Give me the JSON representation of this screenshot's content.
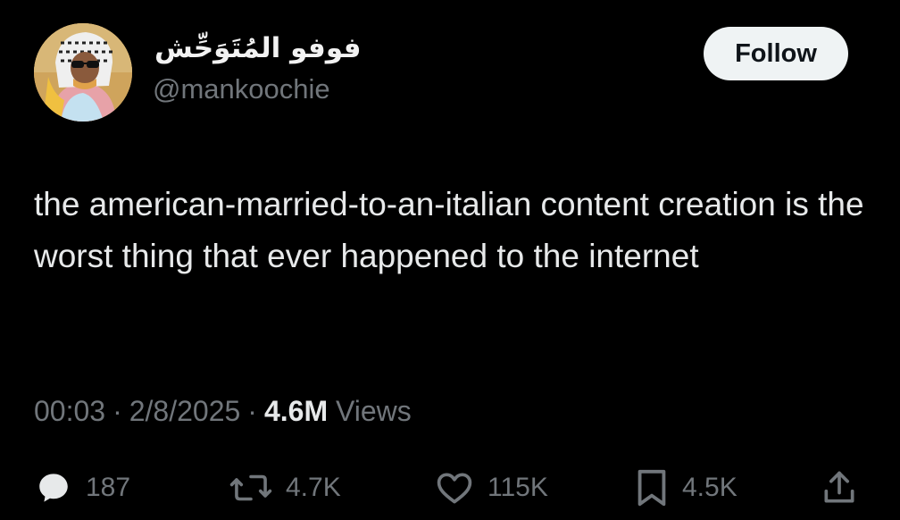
{
  "author": {
    "display_name": "فوفو المُتَوَحِّش",
    "handle": "@mankoochie"
  },
  "follow_label": "Follow",
  "tweet": {
    "text": "the american-married-to-an-italian content creation is the worst thing that ever happened to the internet"
  },
  "meta": {
    "time": "00:03",
    "separator": "·",
    "date": "2/8/2025",
    "views_count": "4.6M",
    "views_label": "Views"
  },
  "actions": {
    "replies": "187",
    "reposts": "4.7K",
    "likes": "115K",
    "bookmarks": "4.5K"
  },
  "icons": {
    "reply": "reply-icon",
    "repost": "repost-icon",
    "like": "heart-icon",
    "bookmark": "bookmark-icon",
    "share": "share-icon"
  },
  "colors": {
    "background": "#000000",
    "primary_text": "#e7e9ea",
    "secondary_text": "#71767b",
    "follow_button_bg": "#eff3f4",
    "follow_button_text": "#0f1419"
  }
}
